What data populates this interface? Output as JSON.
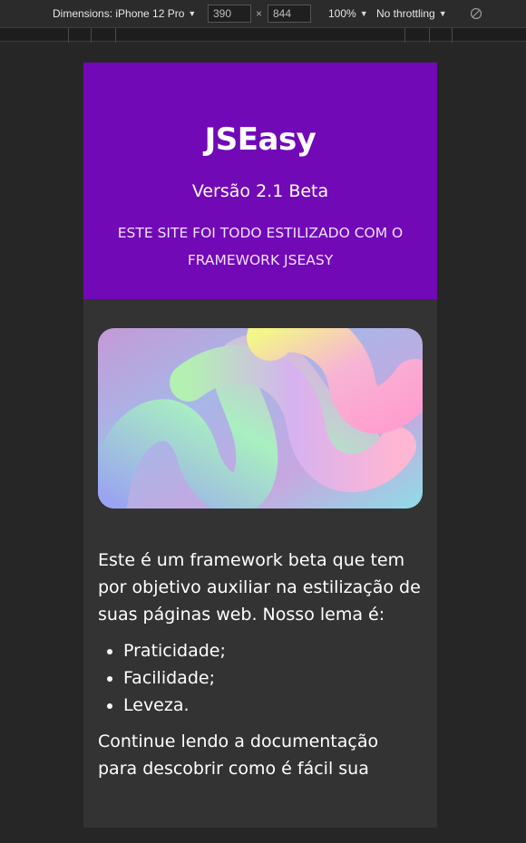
{
  "devtools": {
    "dimensions_label": "Dimensions: iPhone 12 Pro",
    "width_value": "390",
    "height_value": "844",
    "times_sign": "×",
    "zoom_label": "100%",
    "throttle_label": "No throttling",
    "caret": "▼",
    "rotate_icon": "rotate-icon"
  },
  "page": {
    "title": "JSEasy",
    "version": "Versão 2.1 Beta",
    "tagline": "Este site foi todo estilizado com o framework JSEasy",
    "header_color": "#7209b7",
    "body_color": "#333333",
    "intro": "Este é um framework beta que tem por objetivo auxiliar na estilização de suas páginas web. Nosso lema é:",
    "features": [
      "Praticidade;",
      "Facilidade;",
      "Leveza."
    ],
    "continue_text": "Continue lendo a documentação para descobrir como é fácil sua"
  }
}
